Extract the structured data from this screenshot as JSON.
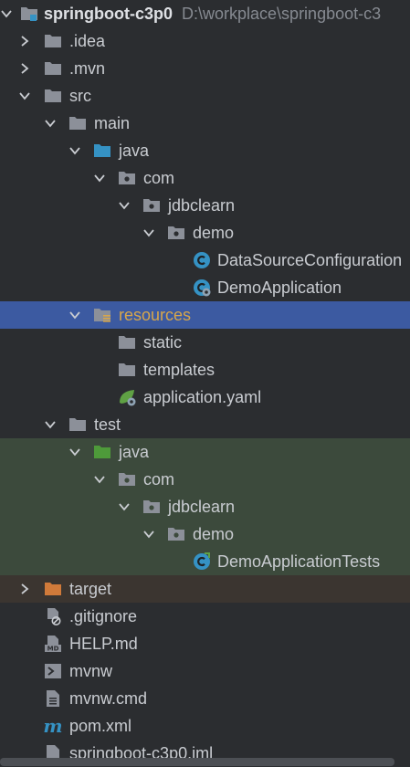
{
  "root": {
    "label": "springboot-c3p0",
    "path": "D:\\workplace\\springboot-c3"
  },
  "nodes": {
    "idea": ".idea",
    "mvn": ".mvn",
    "src": "src",
    "main": "main",
    "java": "java",
    "com": "com",
    "jdbclearn": "jdbclearn",
    "demo": "demo",
    "datasource": "DataSourceConfiguration",
    "demoapp": "DemoApplication",
    "resources": "resources",
    "static": "static",
    "templates": "templates",
    "appyaml": "application.yaml",
    "test": "test",
    "test_java": "java",
    "test_com": "com",
    "test_jdbclearn": "jdbclearn",
    "test_demo": "demo",
    "demotests": "DemoApplicationTests",
    "target": "target",
    "gitignore": ".gitignore",
    "help": "HELP.md",
    "mvnw": "mvnw",
    "mvnwcmd": "mvnw.cmd",
    "pom": "pom.xml",
    "iml": "springboot-c3p0.iml"
  },
  "colors": {
    "background": "#2b2d30",
    "selected": "#3c5aa1",
    "test_bg": "#3c4a3c",
    "excluded_bg": "#3b3530",
    "folder": "#8c9099",
    "source_folder": "#3592c4",
    "test_folder": "#4e9a3a",
    "excluded_folder": "#d07a3a",
    "class_icon": "#3592c4"
  }
}
